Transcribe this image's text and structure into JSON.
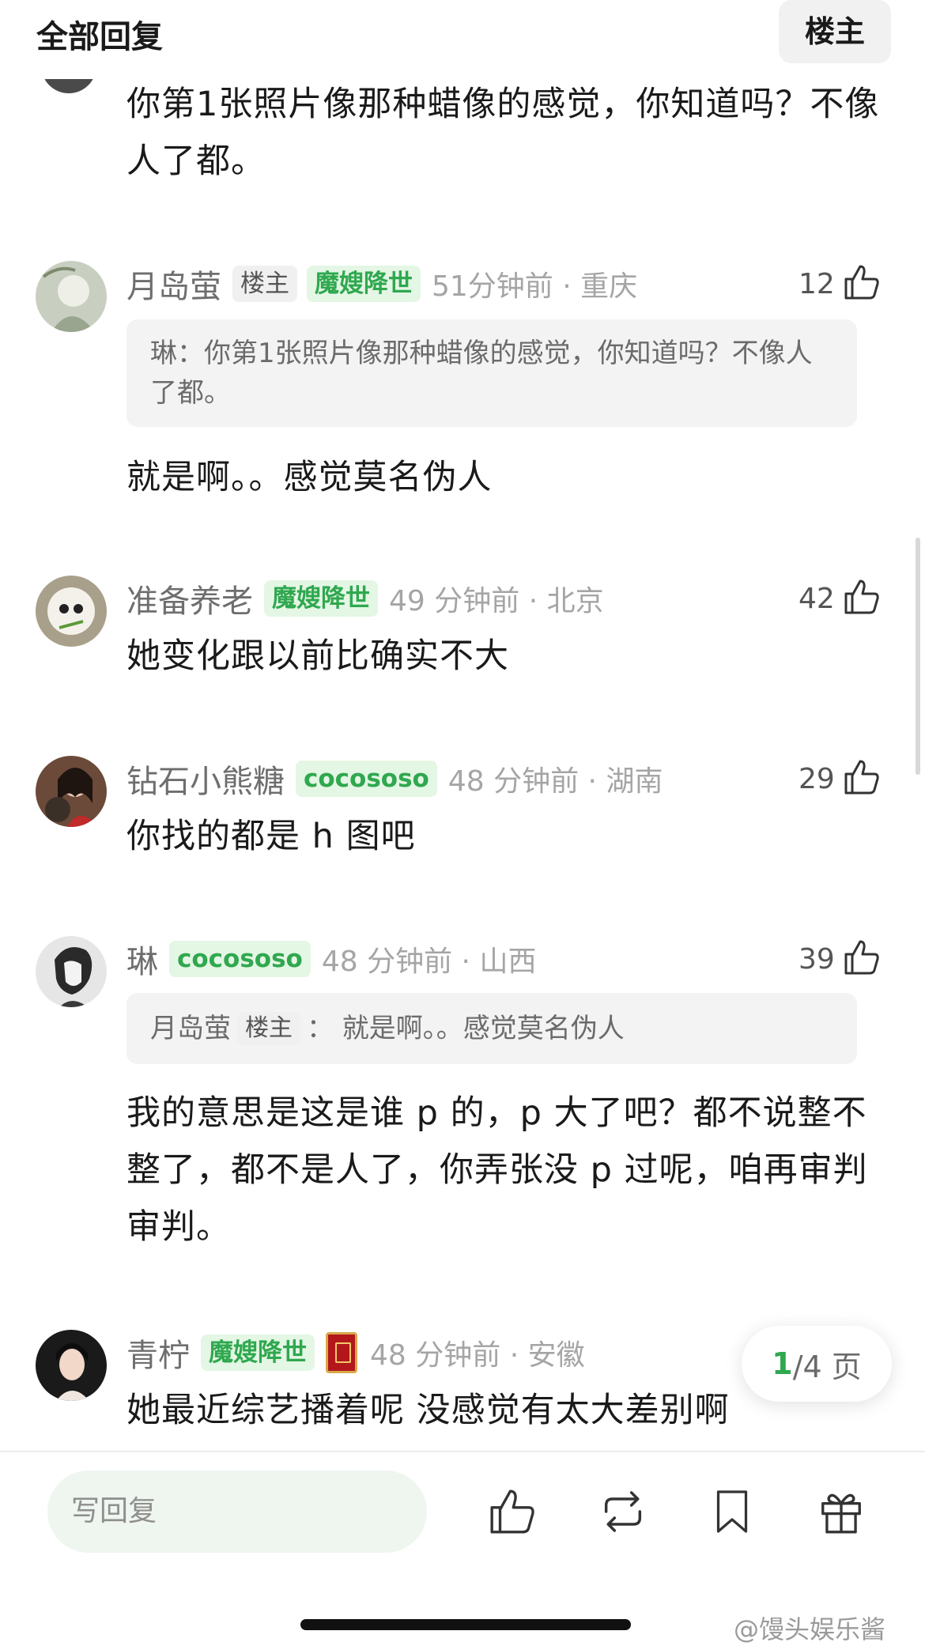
{
  "header": {
    "title": "全部回复",
    "op_button": "楼主"
  },
  "colors": {
    "accent_green": "#2fa84f",
    "badge_green_bg": "#e4f6e4",
    "meta_gray": "#a5a5a5",
    "text_dark": "#1a1a1a"
  },
  "top_comment": {
    "text": "你第1张照片像那种蜡像的感觉，你知道吗？不像人了都。"
  },
  "comments": [
    {
      "username": "月岛萤",
      "op_badge": "楼主",
      "badge": "魔嫂降世",
      "time_location": "51分钟前 · 重庆",
      "likes": "12",
      "quote": {
        "prefix": "琳：",
        "text": "你第1张照片像那种蜡像的感觉，你知道吗？不像人了都。"
      },
      "text": "就是啊。。感觉莫名伪人"
    },
    {
      "username": "准备养老",
      "badge": "魔嫂降世",
      "time_location": "49 分钟前 · 北京",
      "likes": "42",
      "text": "她变化跟以前比确实不大"
    },
    {
      "username": "钻石小熊糖",
      "badge": "cocososo",
      "time_location": "48 分钟前 · 湖南",
      "likes": "29",
      "text": "你找的都是 h 图吧"
    },
    {
      "username": "琳",
      "badge": "cocososo",
      "time_location": "48 分钟前 · 山西",
      "likes": "39",
      "quote": {
        "prefix": "月岛萤",
        "op_badge": "楼主",
        "text": "： 就是啊。。感觉莫名伪人"
      },
      "text": "我的意思是这是谁 p 的，p 大了吧？都不说整不整了，都不是人了，你弄张没 p 过呢，咱再审判审判。"
    },
    {
      "username": "青柠",
      "badge": "魔嫂降世",
      "time_location": "48 分钟前 · 安徽",
      "text": "她最近综艺播着呢 没感觉有太大差别啊"
    }
  ],
  "pagination": {
    "current": "1",
    "total": "/4 页"
  },
  "bottom_bar": {
    "reply_placeholder": "写回复",
    "icons": [
      "like-icon",
      "repost-icon",
      "bookmark-icon",
      "gift-icon"
    ]
  },
  "watermark": "@馒头娱乐酱"
}
